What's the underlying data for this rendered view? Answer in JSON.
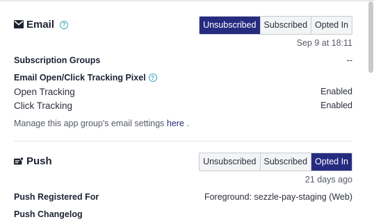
{
  "email": {
    "title": "Email",
    "help": "?",
    "options": [
      "Unsubscribed",
      "Subscribed",
      "Opted In"
    ],
    "active": "Unsubscribed",
    "timestamp": "Sep 9 at 18:11",
    "subscription_groups_label": "Subscription Groups",
    "subscription_groups_value": "--",
    "tracking_pixel_label": "Email Open/Click Tracking Pixel",
    "tracking_help": "?",
    "open_tracking_label": "Open Tracking",
    "open_tracking_value": "Enabled",
    "click_tracking_label": "Click Tracking",
    "click_tracking_value": "Enabled",
    "manage_text": "Manage this app group's email settings",
    "manage_link": "here",
    "manage_end": "."
  },
  "push": {
    "title": "Push",
    "options": [
      "Unsubscribed",
      "Subscribed",
      "Opted In"
    ],
    "active": "Opted In",
    "timestamp": "21 days ago",
    "registered_label": "Push Registered For",
    "registered_value": "Foreground: sezzle-pay-staging (Web)",
    "changelog_label": "Push Changelog"
  },
  "colors": {
    "accent": "#262b80",
    "help": "#3fa6b8"
  },
  "icons": {
    "email": "envelope-icon",
    "push": "push-notification-icon"
  }
}
